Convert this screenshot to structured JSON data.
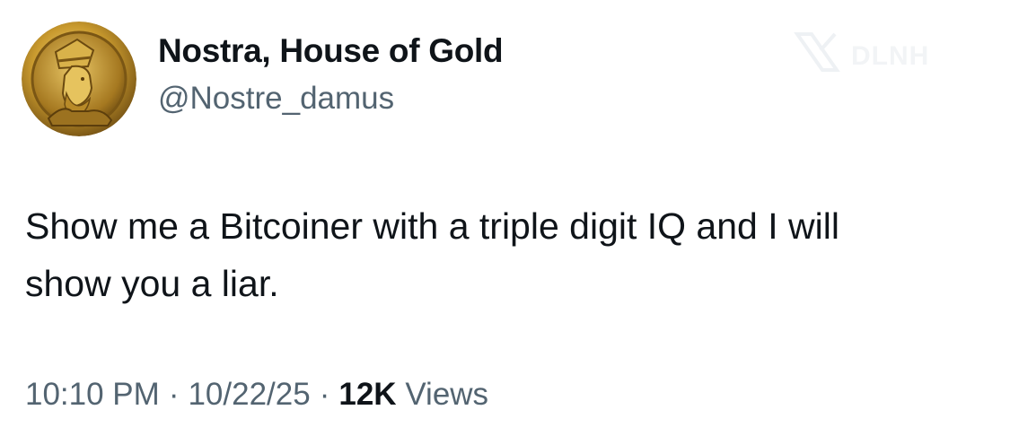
{
  "author": {
    "display_name": "Nostra, House of Gold",
    "handle": "@Nostre_damus",
    "avatar_icon": "gold-coin-portrait-icon"
  },
  "watermark": {
    "icon": "x-logo-icon",
    "text": "DLNH"
  },
  "tweet": {
    "text_lines": [
      "Show me a Bitcoiner with a triple digit IQ and I will",
      "show you a liar."
    ]
  },
  "meta": {
    "time": "10:10 PM",
    "separator": "·",
    "date": "10/22/25",
    "views_count": "12K",
    "views_label": "Views"
  },
  "colors": {
    "text_primary": "#0f1419",
    "text_secondary": "#536471",
    "gold": "#c9a227"
  }
}
